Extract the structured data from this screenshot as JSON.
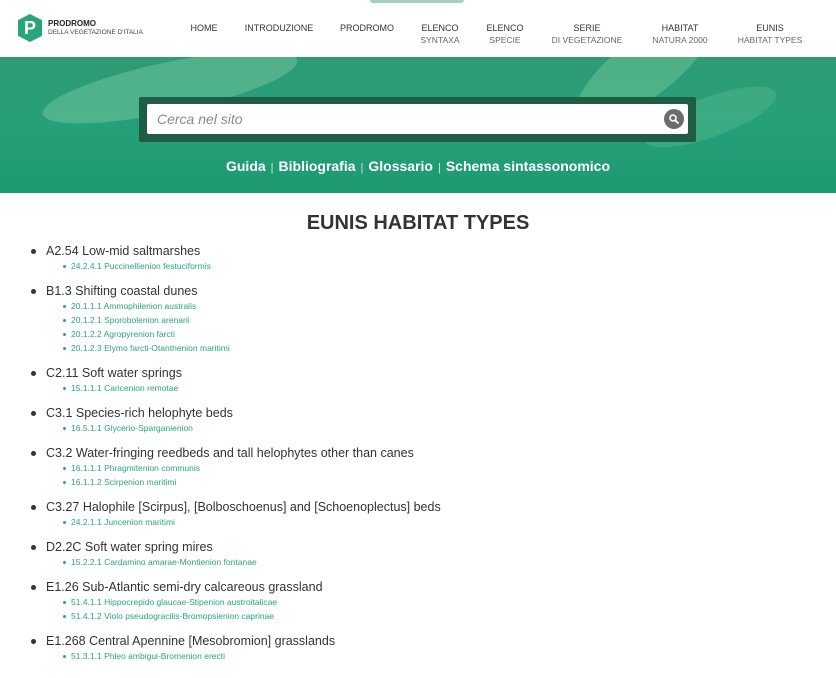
{
  "logo": {
    "title": "PRODROMO",
    "subtitle": "DELLA VEGETAZIONE D'ITALIA",
    "mark": "P"
  },
  "nav": [
    {
      "l1": "HOME",
      "l2": ""
    },
    {
      "l1": "INTRODUZIONE",
      "l2": ""
    },
    {
      "l1": "PRODROMO",
      "l2": ""
    },
    {
      "l1": "ELENCO",
      "l2": "SYNTAXA"
    },
    {
      "l1": "ELENCO",
      "l2": "SPECIE"
    },
    {
      "l1": "SERIE",
      "l2": "DI VEGETAZIONE"
    },
    {
      "l1": "HABITAT",
      "l2": "NATURA 2000"
    },
    {
      "l1": "EUNIS",
      "l2": "HABITAT TYPES"
    }
  ],
  "search": {
    "placeholder": "Cerca nel sito",
    "icon": "search-icon"
  },
  "hero_links": [
    "Guida",
    "Bibliografia",
    "Glossario",
    "Schema sintassonomico"
  ],
  "hero_separator": "|",
  "page_title": "EUNIS HABITAT TYPES",
  "colors": {
    "brand": "#2aa57a",
    "hero": "#27a07a",
    "search_frame": "#1f5d45"
  },
  "groups": [
    {
      "label": "A2.54 Low-mid saltmarshes",
      "items": [
        "24.2.4.1 Puccinellienion festuciformis"
      ]
    },
    {
      "label": "B1.3 Shifting coastal dunes",
      "items": [
        "20.1.1.1 Ammophilenion australis",
        "20.1.2.1 Sporobolenion arenarii",
        "20.1.2.2 Agropyrenion farcti",
        "20.1.2.3 Elymo farcti-Otanthenion maritimi"
      ]
    },
    {
      "label": "C2.11 Soft water springs",
      "items": [
        "15.1.1.1 Caricenion remotae"
      ]
    },
    {
      "label": "C3.1 Species-rich helophyte beds",
      "items": [
        "16.5.1.1 Glycerio-Sparganienion"
      ]
    },
    {
      "label": "C3.2 Water-fringing reedbeds and tall helophytes other than canes",
      "items": [
        "16.1.1.1 Phragmitenion communis",
        "16.1.1.2 Scirpenion maritimi"
      ]
    },
    {
      "label": "C3.27 Halophile [Scirpus], [Bolboschoenus] and [Schoenoplectus] beds",
      "items": [
        "24.2.1.1 Juncenion maritimi"
      ]
    },
    {
      "label": "D2.2C Soft water spring mires",
      "items": [
        "15.2.2.1 Cardamino amarae-Montienion fontanae"
      ]
    },
    {
      "label": "E1.26 Sub-Atlantic semi-dry calcareous grassland",
      "items": [
        "51.4.1.1 Hippocrepido glaucae-Stipenion austroitalicae",
        "51.4.1.2 Violo pseudogracilis-Bromopsienion caprinae"
      ]
    },
    {
      "label": "E1.268 Central Apennine [Mesobromion] grasslands",
      "items": [
        "51.3.1.1 Phleo ambigui-Bromenion erecti"
      ]
    }
  ]
}
